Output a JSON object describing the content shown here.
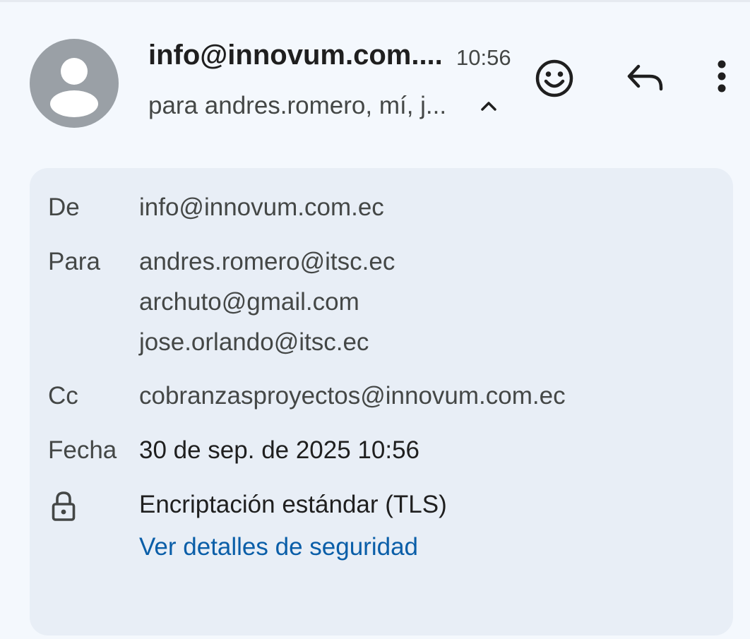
{
  "header": {
    "sender": "info@innovum.com....",
    "time": "10:56",
    "recipients_summary": "para andres.romero, mí, j..."
  },
  "icons": {
    "avatar": "person-avatar-icon",
    "collapse": "chevron-up-icon",
    "emoji": "smiley-icon",
    "reply": "reply-icon",
    "more": "more-vert-icon",
    "lock": "lock-icon"
  },
  "details": {
    "from_label": "De",
    "from_value": "info@innovum.com.ec",
    "to_label": "Para",
    "to_values": [
      "andres.romero@itsc.ec",
      "archuto@gmail.com",
      "jose.orlando@itsc.ec"
    ],
    "cc_label": "Cc",
    "cc_value": "cobranzasproyectos@innovum.com.ec",
    "date_label": "Fecha",
    "date_value": "30 de sep. de 2025 10:56",
    "encryption_text": "Encriptación estándar (TLS)",
    "security_link": "Ver detalles de seguridad"
  },
  "colors": {
    "background": "#f4f8fd",
    "card": "#e8eef6",
    "avatar": "#9aa0a6",
    "link": "#0a5ea8",
    "text_primary": "#1f1f1f",
    "text_secondary": "#444746"
  }
}
